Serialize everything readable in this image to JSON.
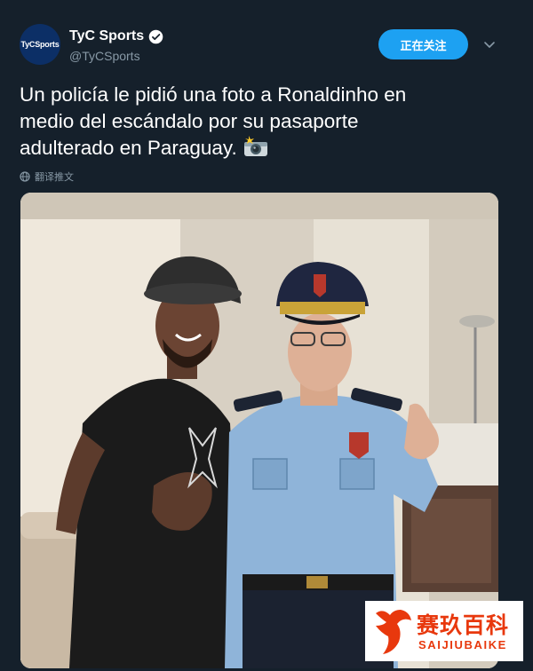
{
  "account": {
    "display_name": "TyC Sports",
    "handle": "@TyCSports",
    "avatar_text": "TyCSports",
    "verified": true
  },
  "follow_button": {
    "label": "正在关注"
  },
  "tweet": {
    "lines": [
      "Un policía le pidió una foto a Ronaldinho en",
      "medio del escándalo por su pasaporte",
      "adulterado en Paraguay."
    ],
    "emoji": "camera-flash-emoji"
  },
  "translate": {
    "label": "翻译推文",
    "icon": "globe-icon"
  },
  "watermark": {
    "label": "赛玖百科",
    "sub": "SAIJIUBAIKE"
  },
  "colors": {
    "background": "#15202b",
    "accent": "#1da1f2",
    "muted": "#8899a6",
    "watermark": "#e8380d"
  }
}
